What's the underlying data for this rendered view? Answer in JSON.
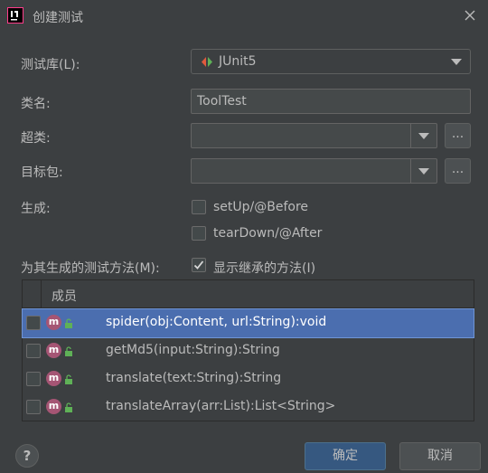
{
  "window": {
    "title": "创建测试"
  },
  "form": {
    "library_label": "测试库(L):",
    "library_value": "JUnit5",
    "classname_label": "类名:",
    "classname_value": "ToolTest",
    "superclass_label": "超类:",
    "superclass_value": "",
    "package_label": "目标包:",
    "package_value": "",
    "browse_label": "...",
    "generate_label": "生成:",
    "setup_label": "setUp/@Before",
    "setup_checked": false,
    "teardown_label": "tearDown/@After",
    "teardown_checked": false,
    "methods_label": "为其生成的测试方法(M):",
    "inherited_label": "显示继承的方法(I)",
    "inherited_checked": true
  },
  "table": {
    "header": "成员",
    "rows": [
      {
        "text": "spider(obj:Content, url:String):void",
        "checked": false,
        "selected": true,
        "icon": "m-method-icon"
      },
      {
        "text": "getMd5(input:String):String",
        "checked": false,
        "selected": false,
        "icon": "m-method-icon"
      },
      {
        "text": "translate(text:String):String",
        "checked": false,
        "selected": false,
        "icon": "m-method-icon"
      },
      {
        "text": "translateArray(arr:List):List<String>",
        "checked": false,
        "selected": false,
        "icon": "m-method-icon"
      }
    ]
  },
  "buttons": {
    "help": "?",
    "ok": "确定",
    "cancel": "取消"
  },
  "colors": {
    "background": "#3c3f41",
    "selection": "#4b6eaf",
    "ok_button": "#365880",
    "method_icon": "#a55574"
  }
}
